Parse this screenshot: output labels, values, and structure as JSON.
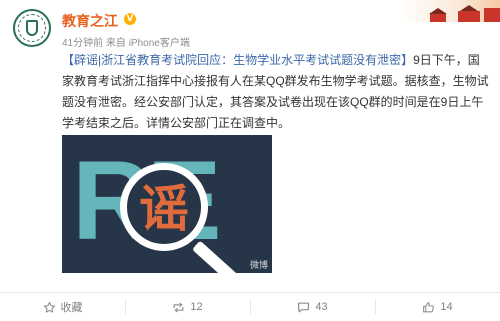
{
  "post": {
    "user_name": "教育之江",
    "verified_mark": "V",
    "time": "41分钟前",
    "source_prefix": "来自",
    "source": "iPhone客户端",
    "content": {
      "topic": "【辟谣|浙江省教育考试院回应：生物学业水平考试试题没有泄密】",
      "body": "9日下午，国家教育考试浙江指挥中心接报有人在某QQ群发布生物学考试题。据核查，生物试题没有泄密。经公安部门认定，其答案及试卷出现在该QQ群的时间是在9日上午学考结束之后。详情公安部门正在调查中。"
    },
    "image": {
      "letters": "RE",
      "lens_char": "谣",
      "watermark": "微博"
    }
  },
  "actions": {
    "favorite": {
      "label": "收藏",
      "icon": "star-icon"
    },
    "repost": {
      "count": "12",
      "icon": "repost-icon"
    },
    "comment": {
      "count": "43",
      "icon": "comment-icon"
    },
    "like": {
      "count": "14",
      "icon": "thumb-up-icon"
    }
  },
  "colors": {
    "user_name": "#e8611f",
    "topic_link": "#3b68a8",
    "image_bg": "#273548",
    "letters": "#65b6bb",
    "lens_char": "#e26b3d"
  }
}
